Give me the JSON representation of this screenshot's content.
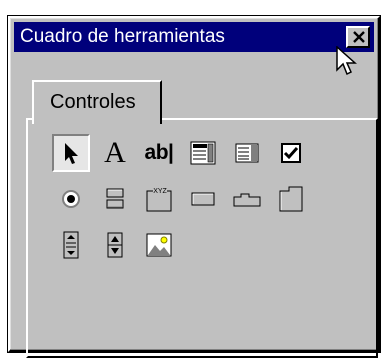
{
  "window": {
    "title": "Cuadro de herramientas",
    "close_icon": "close-icon"
  },
  "tabs": [
    {
      "label": "Controles",
      "selected": true
    }
  ],
  "toolbox": {
    "items": [
      {
        "name": "select-pointer",
        "icon": "arrow-pointer-icon",
        "pressed": true
      },
      {
        "name": "label",
        "icon": "label-A-icon",
        "text": "A"
      },
      {
        "name": "text-box",
        "icon": "textbox-icon",
        "text": "ab|"
      },
      {
        "name": "combo-box",
        "icon": "combo-box-icon"
      },
      {
        "name": "list-box",
        "icon": "list-box-icon"
      },
      {
        "name": "check-box",
        "icon": "checkbox-icon"
      },
      {
        "name": "option-button",
        "icon": "radio-button-icon"
      },
      {
        "name": "toggle-button",
        "icon": "toggle-button-icon"
      },
      {
        "name": "frame",
        "icon": "frame-icon",
        "text": "XYZ"
      },
      {
        "name": "command-button",
        "icon": "command-button-icon"
      },
      {
        "name": "tab-strip",
        "icon": "tab-strip-icon"
      },
      {
        "name": "multi-page",
        "icon": "multipage-icon"
      },
      {
        "name": "scroll-bar",
        "icon": "scroll-bar-icon"
      },
      {
        "name": "spin-button",
        "icon": "spin-button-icon"
      },
      {
        "name": "image",
        "icon": "image-icon"
      }
    ]
  }
}
